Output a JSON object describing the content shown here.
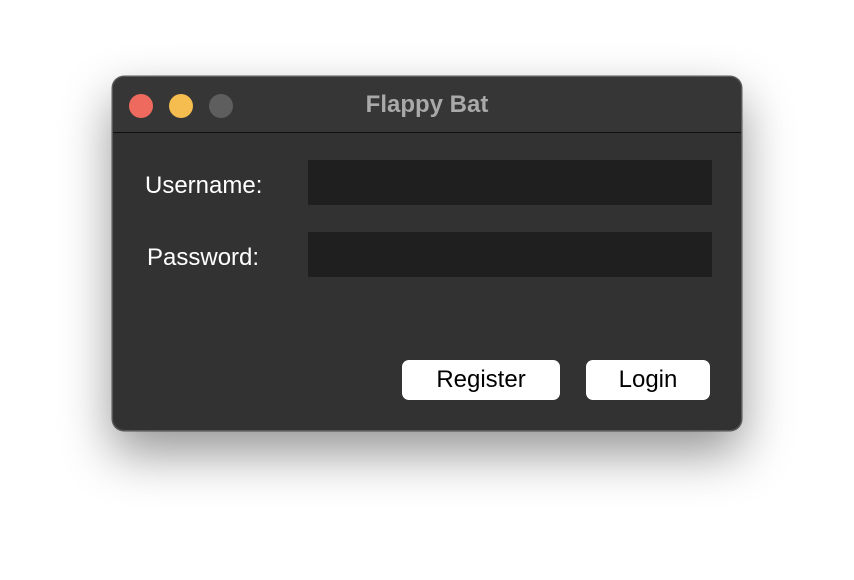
{
  "window": {
    "title": "Flappy Bat",
    "traffic_lights": {
      "close_color": "#ee6a5e",
      "minimize_color": "#f5bd4f",
      "zoom_color": "#5e5e5e"
    }
  },
  "form": {
    "username_label": "Username:",
    "username_value": "",
    "password_label": "Password:",
    "password_value": ""
  },
  "buttons": {
    "register_label": "Register",
    "login_label": "Login"
  }
}
